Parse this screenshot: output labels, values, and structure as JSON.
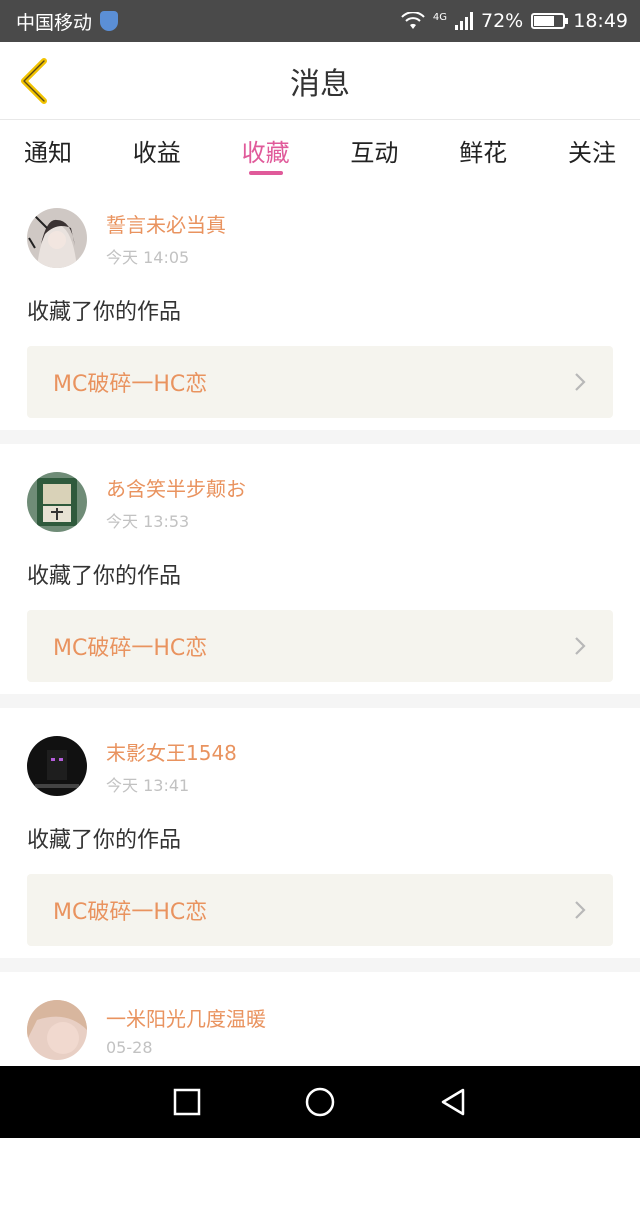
{
  "status_bar": {
    "carrier": "中国移动",
    "network": "4G",
    "battery": "72%",
    "battery_level": 0.72,
    "time": "18:49"
  },
  "header": {
    "title": "消息"
  },
  "tabs": [
    {
      "label": "通知",
      "active": false
    },
    {
      "label": "收益",
      "active": false
    },
    {
      "label": "收藏",
      "active": true
    },
    {
      "label": "互动",
      "active": false
    },
    {
      "label": "鲜花",
      "active": false
    },
    {
      "label": "关注",
      "active": false
    }
  ],
  "messages": [
    {
      "username": "誓言未必当真",
      "time": "今天 14:05",
      "action": "收藏了你的作品",
      "work_title": "MC破碎一HC恋"
    },
    {
      "username": "あ含笑半步颠お",
      "time": "今天 13:53",
      "action": "收藏了你的作品",
      "work_title": "MC破碎一HC恋"
    },
    {
      "username": "末影女王1548",
      "time": "今天 13:41",
      "action": "收藏了你的作品",
      "work_title": "MC破碎一HC恋"
    },
    {
      "username": "一米阳光几度温暖",
      "time": "05-28"
    }
  ],
  "colors": {
    "accent": "#e05a9a",
    "name": "#e9935f",
    "back_arrow": "#f2c300"
  }
}
